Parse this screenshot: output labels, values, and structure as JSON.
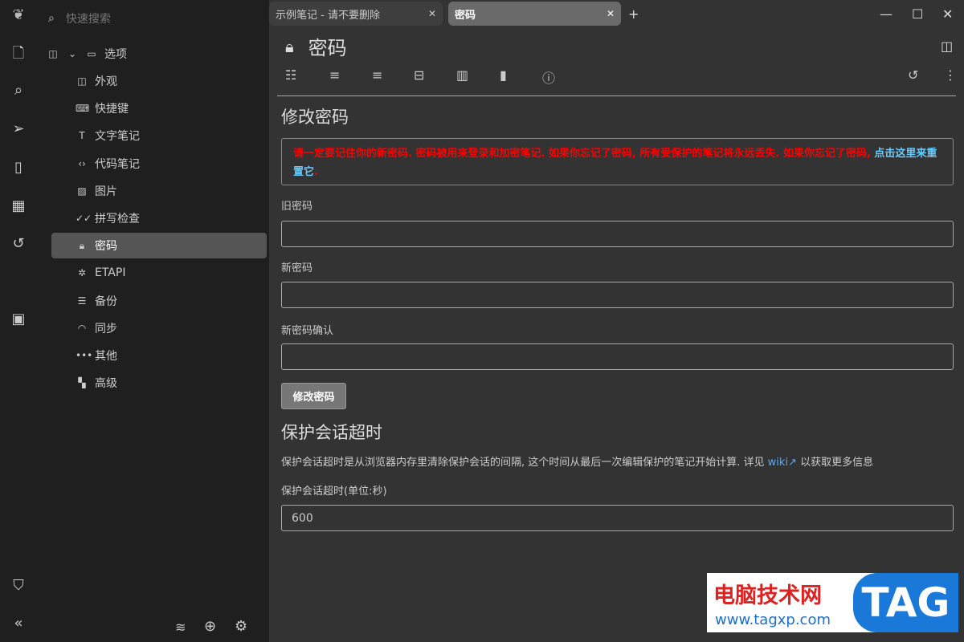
{
  "search": {
    "placeholder": "快速搜索"
  },
  "tree": {
    "root": "选项",
    "items": [
      {
        "label": "外观",
        "icon": "layout-icon"
      },
      {
        "label": "快捷键",
        "icon": "keyboard-icon"
      },
      {
        "label": "文字笔记",
        "icon": "text-icon"
      },
      {
        "label": "代码笔记",
        "icon": "code-icon"
      },
      {
        "label": "图片",
        "icon": "image-icon"
      },
      {
        "label": "拼写检查",
        "icon": "check-icon"
      },
      {
        "label": "密码",
        "icon": "lock-icon"
      },
      {
        "label": "ETAPI",
        "icon": "puzzle-icon"
      },
      {
        "label": "备份",
        "icon": "database-icon"
      },
      {
        "label": "同步",
        "icon": "wifi-icon"
      },
      {
        "label": "其他",
        "icon": "dots-icon"
      },
      {
        "label": "高级",
        "icon": "grid-icon"
      }
    ]
  },
  "tabs": [
    {
      "label": "示例笔记 - 请不要删除"
    },
    {
      "label": "密码"
    }
  ],
  "note": {
    "title": "密码"
  },
  "change": {
    "heading": "修改密码",
    "warning": "请一定要记住你的新密码. 密码被用来登录和加密笔记. 如果你忘记了密码, 所有受保护的笔记将永远丢失. 如果你忘记了密码, ",
    "reset_link": "点击这里来重置它",
    "period": ".",
    "old_label": "旧密码",
    "new_label": "新密码",
    "confirm_label": "新密码确认",
    "button": "修改密码"
  },
  "timeout": {
    "heading": "保护会话超时",
    "desc1": "保护会话超时是从浏览器内存里清除保护会话的间隔, 这个时间从最后一次编辑保护的笔记开始计算. 详见 ",
    "wiki": "wiki↗",
    "desc2": " 以获取更多信息",
    "label": "保护会话超时(单位:秒)",
    "value": "600"
  },
  "watermark": {
    "cn": "电脑技术网",
    "url": "www.tagxp.com",
    "tag": "TAG"
  }
}
